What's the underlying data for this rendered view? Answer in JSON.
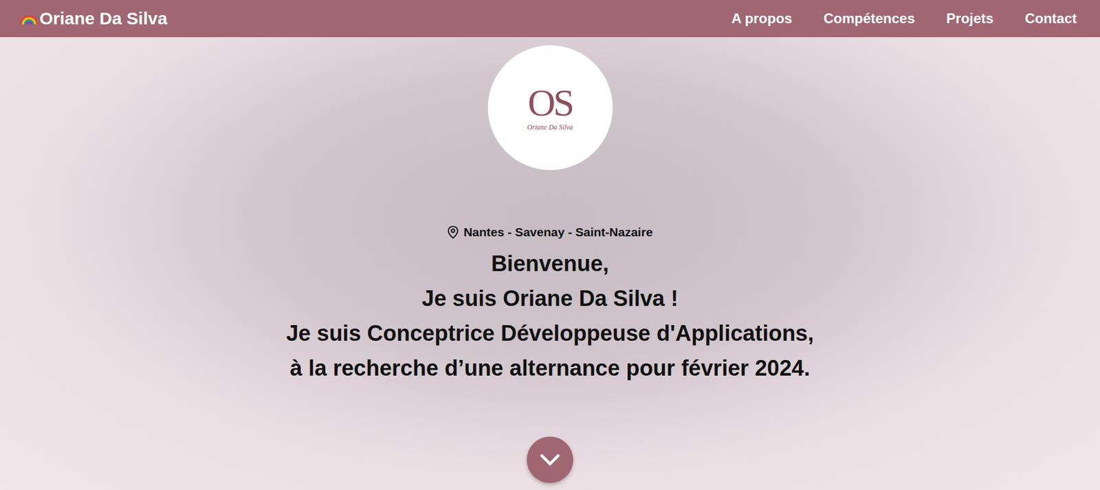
{
  "navbar": {
    "brand": "Oriane Da Silva",
    "links": [
      "A propos",
      "Compétences",
      "Projets",
      "Contact"
    ]
  },
  "hero": {
    "logo": {
      "monogram": "OS",
      "signature": "Oriane Da Silva"
    },
    "location": "Nantes - Savenay - Saint-Nazaire",
    "lines": [
      "Bienvenue,",
      "Je suis Oriane Da Silva !",
      "Je suis Conceptrice Développeuse d'Applications,",
      "à la recherche d’une alternance pour février 2024."
    ]
  }
}
